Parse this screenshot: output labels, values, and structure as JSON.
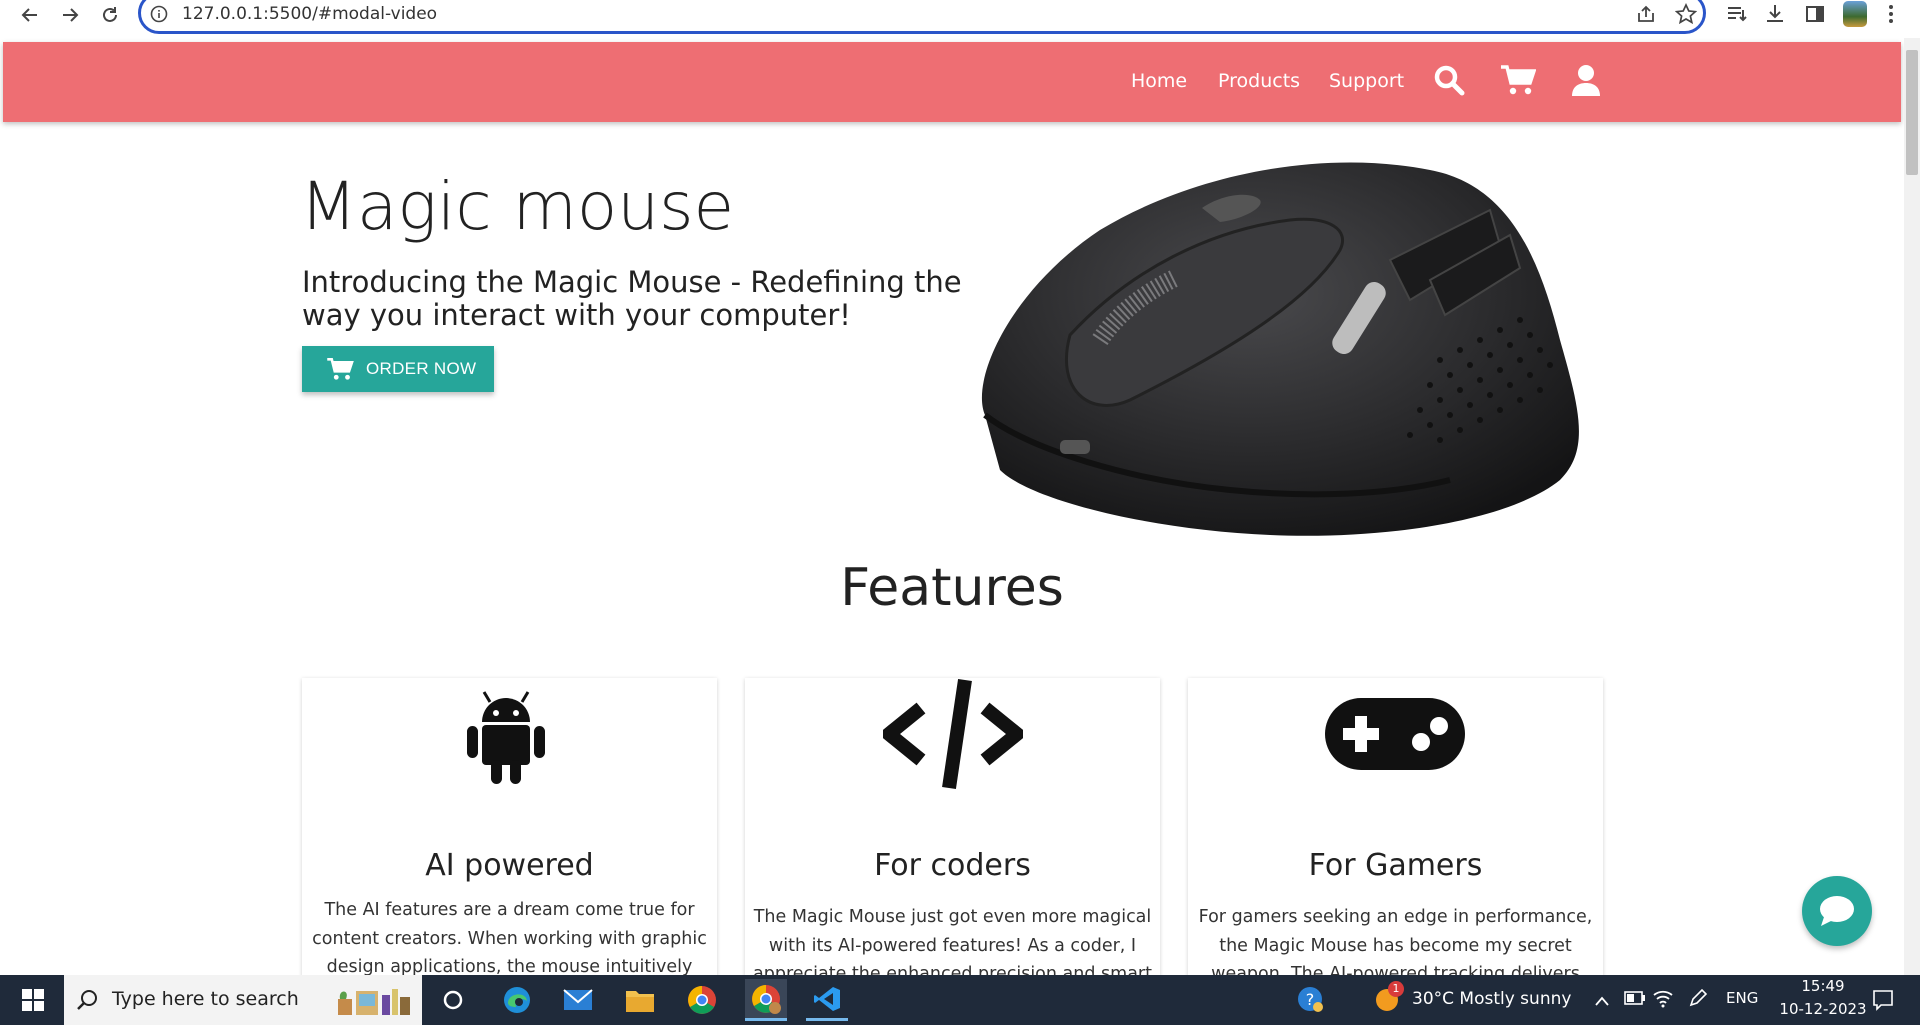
{
  "browser": {
    "url": "127.0.0.1:5500/#modal-video"
  },
  "navbar": {
    "links": [
      "Home",
      "Products",
      "Support"
    ]
  },
  "hero": {
    "title": "Magic mouse",
    "subtitle": "Introducing the Magic Mouse - Redefining the way you interact with your computer!",
    "order_label": "ORDER NOW"
  },
  "features": {
    "title": "Features",
    "cards": [
      {
        "icon": "android-icon",
        "title": "AI powered",
        "text": "The AI features are a dream come true for content creators. When working with graphic design applications, the mouse intuitively predicts my next move, making complex tasks feel like second"
      },
      {
        "icon": "code-icon",
        "title": "For coders",
        "text": "The Magic Mouse just got even more magical with its AI-powered features! As a coder, I appreciate the enhanced precision and smart contextual predictions while navigating through"
      },
      {
        "icon": "gamepad-icon",
        "title": "For Gamers",
        "text": "For gamers seeking an edge in performance, the Magic Mouse has become my secret weapon. The AI-powered tracking delivers ultra-precise movements. Sleek design adds a touch of"
      }
    ]
  },
  "taskbar": {
    "search_placeholder": "Type here to search",
    "weather": "30°C  Mostly sunny",
    "weather_badge": "1",
    "language": "ENG",
    "time": "15:49",
    "date": "10-12-2023"
  },
  "colors": {
    "navbar": "#ee6e73",
    "accent": "#26a69a",
    "taskbar": "#1f2a3a"
  }
}
